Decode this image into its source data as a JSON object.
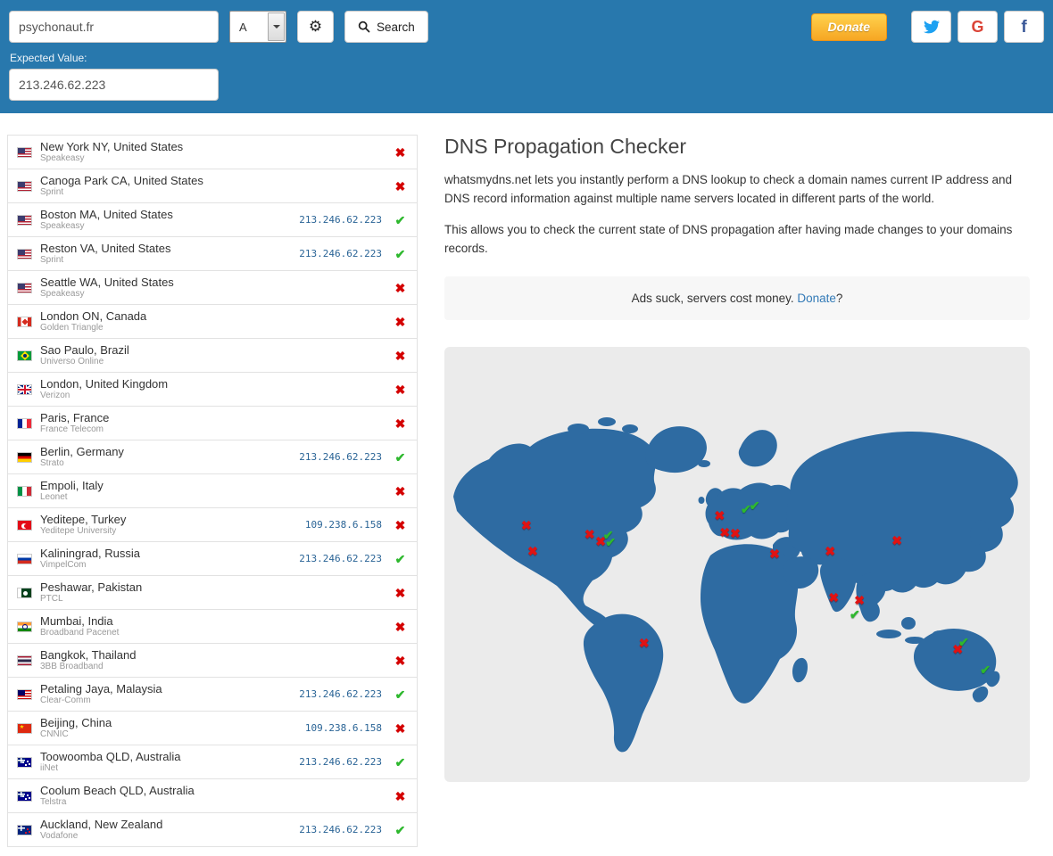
{
  "header": {
    "domain_value": "psychonaut.fr",
    "record_type": "A",
    "search_label": "Search",
    "expected_label": "Expected Value:",
    "expected_value": "213.246.62.223",
    "donate_label": "Donate"
  },
  "icons": {
    "gear": "⚙",
    "check": "✔",
    "cross": "✖",
    "google": "G",
    "facebook": "f"
  },
  "colors": {
    "header-bg": "#2878ad",
    "map-fill": "#2e6ba2",
    "status-ok": "#2eb82e",
    "status-fail": "#d40000",
    "ip-text": "#2a6496",
    "link": "#337ab7",
    "donate-top": "#ffd24d",
    "donate-bottom": "#f6a623"
  },
  "content": {
    "title": "DNS Propagation Checker",
    "paragraph1": "whatsmydns.net lets you instantly perform a DNS lookup to check a domain names current IP address and DNS record information against multiple name servers located in different parts of the world.",
    "paragraph2": "This allows you to check the current state of DNS propagation after having made changes to your domains records.",
    "ad_text": "Ads suck, servers cost money. ",
    "ad_link": "Donate",
    "ad_suffix": "?"
  },
  "results": [
    {
      "flag": "us",
      "location": "New York NY, United States",
      "provider": "Speakeasy",
      "ip": "",
      "status": "fail"
    },
    {
      "flag": "us",
      "location": "Canoga Park CA, United States",
      "provider": "Sprint",
      "ip": "",
      "status": "fail"
    },
    {
      "flag": "us",
      "location": "Boston MA, United States",
      "provider": "Speakeasy",
      "ip": "213.246.62.223",
      "status": "ok"
    },
    {
      "flag": "us",
      "location": "Reston VA, United States",
      "provider": "Sprint",
      "ip": "213.246.62.223",
      "status": "ok"
    },
    {
      "flag": "us",
      "location": "Seattle WA, United States",
      "provider": "Speakeasy",
      "ip": "",
      "status": "fail"
    },
    {
      "flag": "ca",
      "location": "London ON, Canada",
      "provider": "Golden Triangle",
      "ip": "",
      "status": "fail"
    },
    {
      "flag": "br",
      "location": "Sao Paulo, Brazil",
      "provider": "Universo Online",
      "ip": "",
      "status": "fail"
    },
    {
      "flag": "gb",
      "location": "London, United Kingdom",
      "provider": "Verizon",
      "ip": "",
      "status": "fail"
    },
    {
      "flag": "fr",
      "location": "Paris, France",
      "provider": "France Telecom",
      "ip": "",
      "status": "fail"
    },
    {
      "flag": "de",
      "location": "Berlin, Germany",
      "provider": "Strato",
      "ip": "213.246.62.223",
      "status": "ok"
    },
    {
      "flag": "it",
      "location": "Empoli, Italy",
      "provider": "Leonet",
      "ip": "",
      "status": "fail"
    },
    {
      "flag": "tr",
      "location": "Yeditepe, Turkey",
      "provider": "Yeditepe University",
      "ip": "109.238.6.158",
      "status": "fail"
    },
    {
      "flag": "ru",
      "location": "Kaliningrad, Russia",
      "provider": "VimpelCom",
      "ip": "213.246.62.223",
      "status": "ok"
    },
    {
      "flag": "pk",
      "location": "Peshawar, Pakistan",
      "provider": "PTCL",
      "ip": "",
      "status": "fail"
    },
    {
      "flag": "in",
      "location": "Mumbai, India",
      "provider": "Broadband Pacenet",
      "ip": "",
      "status": "fail"
    },
    {
      "flag": "th",
      "location": "Bangkok, Thailand",
      "provider": "3BB Broadband",
      "ip": "",
      "status": "fail"
    },
    {
      "flag": "my",
      "location": "Petaling Jaya, Malaysia",
      "provider": "Clear-Comm",
      "ip": "213.246.62.223",
      "status": "ok"
    },
    {
      "flag": "cn",
      "location": "Beijing, China",
      "provider": "CNNIC",
      "ip": "109.238.6.158",
      "status": "fail"
    },
    {
      "flag": "au",
      "location": "Toowoomba QLD, Australia",
      "provider": "iiNet",
      "ip": "213.246.62.223",
      "status": "ok"
    },
    {
      "flag": "au",
      "location": "Coolum Beach QLD, Australia",
      "provider": "Telstra",
      "ip": "",
      "status": "fail"
    },
    {
      "flag": "nz",
      "location": "Auckland, New Zealand",
      "provider": "Vodafone",
      "ip": "213.246.62.223",
      "status": "ok"
    }
  ],
  "map": {
    "markers": [
      {
        "x": 14.0,
        "y": 41.0,
        "status": "fail"
      },
      {
        "x": 15.1,
        "y": 46.9,
        "status": "fail"
      },
      {
        "x": 24.8,
        "y": 43.0,
        "status": "fail"
      },
      {
        "x": 26.7,
        "y": 44.7,
        "status": "fail"
      },
      {
        "x": 28.0,
        "y": 43.2,
        "status": "ok"
      },
      {
        "x": 28.4,
        "y": 44.9,
        "status": "ok"
      },
      {
        "x": 34.1,
        "y": 68.0,
        "status": "fail"
      },
      {
        "x": 47.0,
        "y": 38.7,
        "status": "fail"
      },
      {
        "x": 47.9,
        "y": 42.6,
        "status": "fail"
      },
      {
        "x": 49.7,
        "y": 42.8,
        "status": "fail"
      },
      {
        "x": 51.5,
        "y": 37.3,
        "status": "ok"
      },
      {
        "x": 53.0,
        "y": 36.5,
        "status": "ok"
      },
      {
        "x": 56.4,
        "y": 47.7,
        "status": "fail"
      },
      {
        "x": 65.9,
        "y": 46.9,
        "status": "fail"
      },
      {
        "x": 66.5,
        "y": 57.6,
        "status": "fail"
      },
      {
        "x": 70.9,
        "y": 58.2,
        "status": "fail"
      },
      {
        "x": 70.1,
        "y": 61.5,
        "status": "ok"
      },
      {
        "x": 77.3,
        "y": 44.5,
        "status": "fail"
      },
      {
        "x": 87.7,
        "y": 69.5,
        "status": "fail"
      },
      {
        "x": 88.7,
        "y": 67.8,
        "status": "ok"
      },
      {
        "x": 92.4,
        "y": 74.2,
        "status": "ok"
      }
    ]
  }
}
